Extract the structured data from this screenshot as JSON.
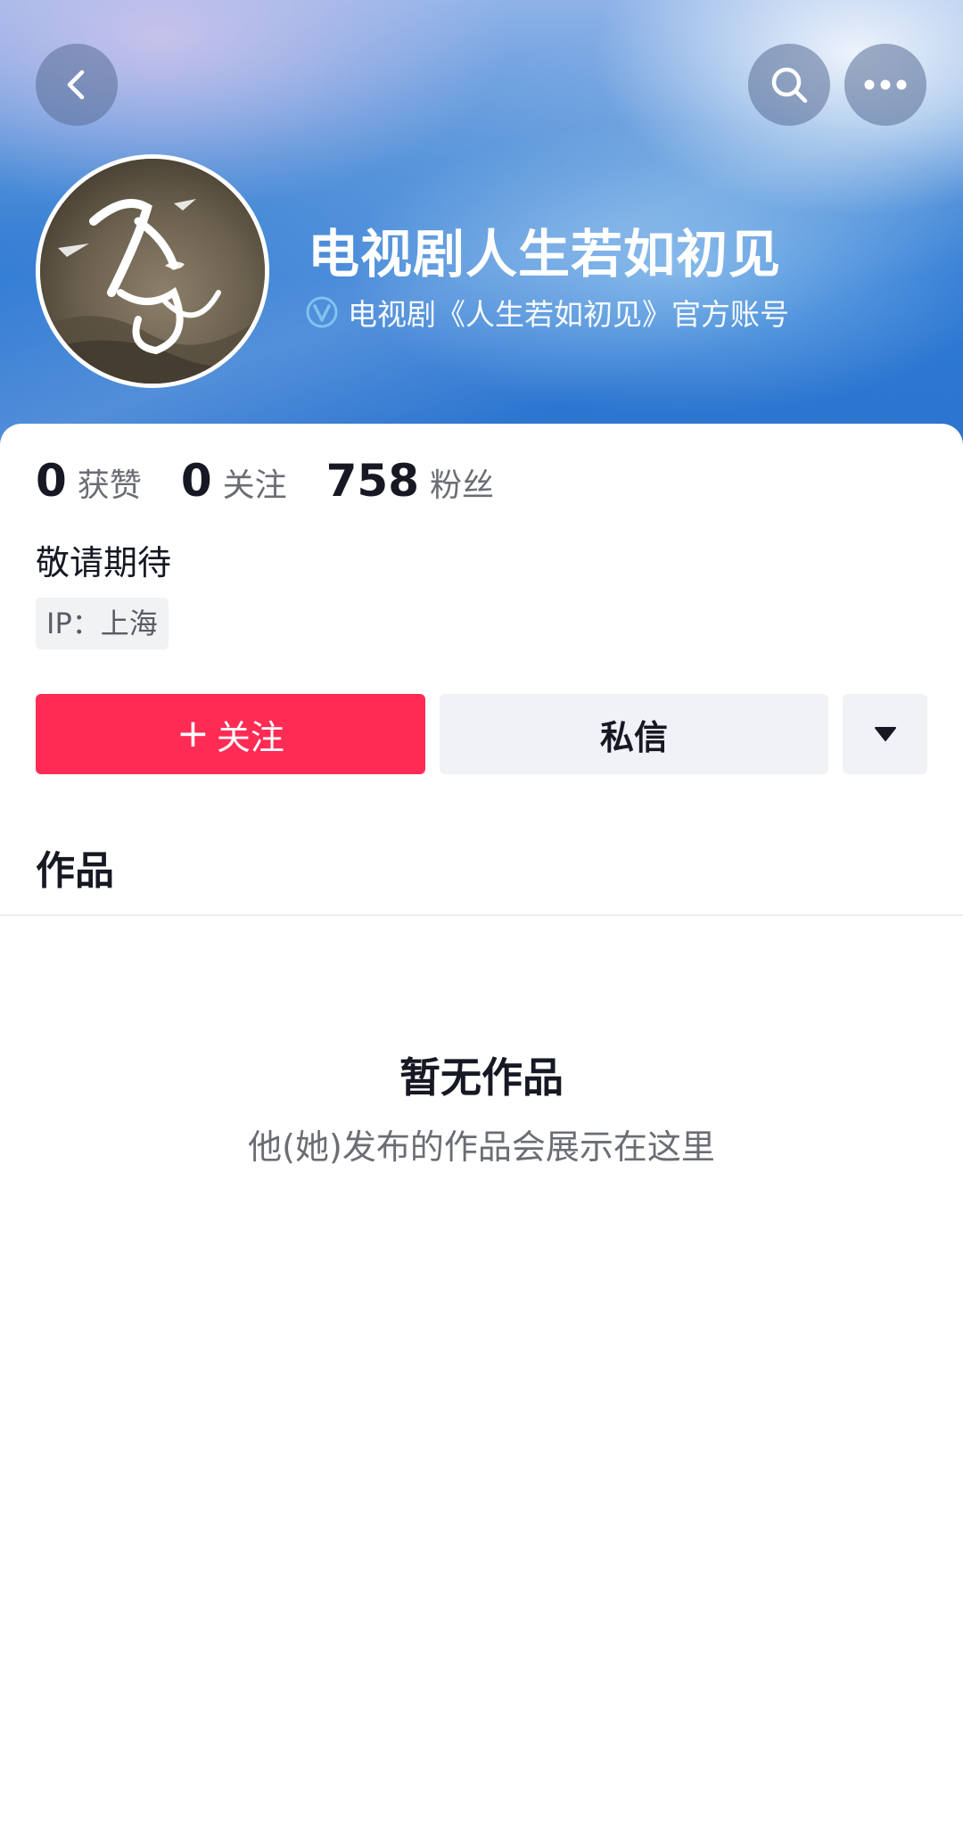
{
  "header": {
    "back_icon": "chevron-left-icon",
    "search_icon": "search-icon",
    "more_icon": "more-horizontal-icon"
  },
  "profile": {
    "name": "电视剧人生若如初见",
    "verification_text": "电视剧《人生若如初见》官方账号",
    "verified_icon": "verified-v-icon",
    "accent_color": "#fe2c55",
    "verified_color": "#7fc3f0"
  },
  "stats": [
    {
      "value": "0",
      "label": "获赞"
    },
    {
      "value": "0",
      "label": "关注"
    },
    {
      "value": "758",
      "label": "粉丝"
    }
  ],
  "bio": "敬请期待",
  "ip_location": "IP：上海",
  "actions": {
    "follow_label": "关注",
    "follow_icon": "+",
    "message_label": "私信",
    "dropdown_icon": "triangle-down-icon"
  },
  "tabs": {
    "works_label": "作品"
  },
  "empty_state": {
    "title": "暂无作品",
    "subtitle": "他(她)发布的作品会展示在这里"
  }
}
